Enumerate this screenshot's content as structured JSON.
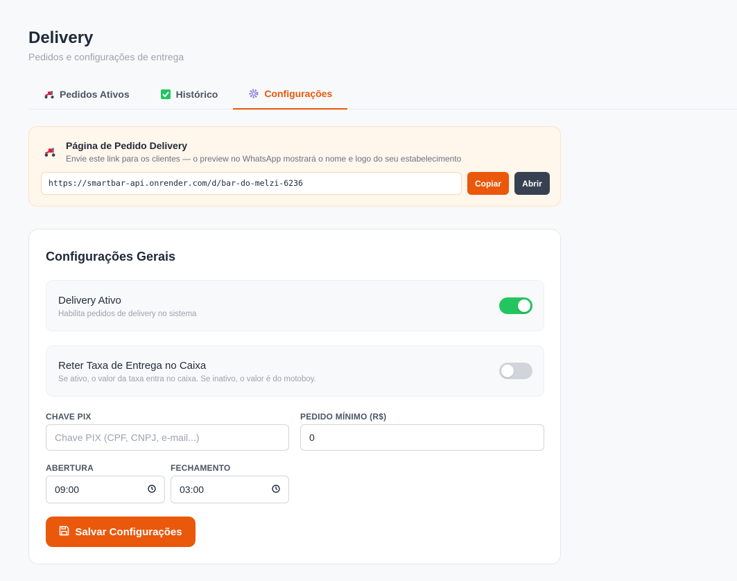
{
  "header": {
    "title": "Delivery",
    "subtitle": "Pedidos e configurações de entrega"
  },
  "tabs": [
    {
      "label": "Pedidos Ativos",
      "icon": "scooter-icon",
      "active": false
    },
    {
      "label": "Histórico",
      "icon": "check-box-icon",
      "active": false
    },
    {
      "label": "Configurações",
      "icon": "gear-icon",
      "active": true
    }
  ],
  "link_card": {
    "title": "Página de Pedido Delivery",
    "description": "Envie este link para os clientes — o preview no WhatsApp mostrará o nome e logo do seu estabelecimento",
    "url": "https://smartbar-api.onrender.com/d/bar-do-melzi-6236",
    "copy_label": "Copiar",
    "open_label": "Abrir"
  },
  "settings": {
    "title": "Configurações Gerais",
    "delivery_active": {
      "label": "Delivery Ativo",
      "hint": "Habilita pedidos de delivery no sistema",
      "on": true
    },
    "retain_fee": {
      "label": "Reter Taxa de Entrega no Caixa",
      "hint": "Se ativo, o valor da taxa entra no caixa. Se inativo, o valor é do motoboy.",
      "on": false
    },
    "pix": {
      "label": "CHAVE PIX",
      "placeholder": "Chave PIX (CPF, CNPJ, e-mail...)",
      "value": ""
    },
    "min_order": {
      "label": "PEDIDO MÍNIMO (R$)",
      "value": "0"
    },
    "opening": {
      "label": "ABERTURA",
      "value": "09:00"
    },
    "closing": {
      "label": "FECHAMENTO",
      "value": "03:00"
    },
    "save_label": "Salvar Configurações"
  },
  "colors": {
    "accent": "#ea580c",
    "toggle_on": "#22c55e",
    "dark_button": "#374151"
  }
}
